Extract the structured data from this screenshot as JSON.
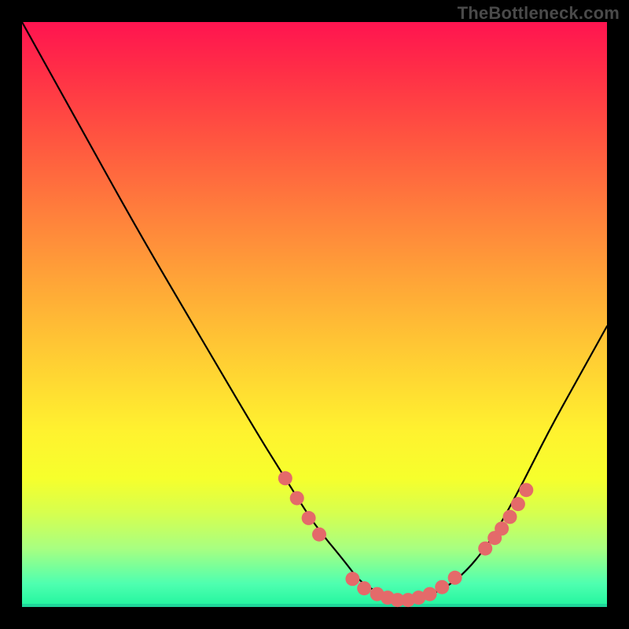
{
  "watermark": "TheBottleneck.com",
  "chart_data": {
    "type": "line",
    "title": "",
    "xlabel": "",
    "ylabel": "",
    "xlim": [
      0,
      1
    ],
    "ylim": [
      0,
      1
    ],
    "grid": false,
    "legend": false,
    "background": "rainbow-gradient",
    "series": [
      {
        "name": "bottleneck-curve",
        "color": "#000000",
        "x": [
          0.0,
          0.1,
          0.2,
          0.3,
          0.4,
          0.45,
          0.5,
          0.55,
          0.58,
          0.62,
          0.66,
          0.7,
          0.75,
          0.8,
          0.85,
          0.9,
          0.95,
          1.0
        ],
        "y": [
          1.0,
          0.82,
          0.64,
          0.47,
          0.3,
          0.22,
          0.14,
          0.08,
          0.04,
          0.02,
          0.01,
          0.02,
          0.05,
          0.11,
          0.2,
          0.3,
          0.39,
          0.48
        ]
      }
    ],
    "markers": [
      {
        "name": "highlight-dots",
        "color": "#e46a6a",
        "radius": 9,
        "points": [
          {
            "x": 0.45,
            "y": 0.22
          },
          {
            "x": 0.47,
            "y": 0.186
          },
          {
            "x": 0.49,
            "y": 0.152
          },
          {
            "x": 0.508,
            "y": 0.124
          },
          {
            "x": 0.565,
            "y": 0.048
          },
          {
            "x": 0.585,
            "y": 0.032
          },
          {
            "x": 0.607,
            "y": 0.022
          },
          {
            "x": 0.625,
            "y": 0.016
          },
          {
            "x": 0.642,
            "y": 0.012
          },
          {
            "x": 0.66,
            "y": 0.012
          },
          {
            "x": 0.678,
            "y": 0.016
          },
          {
            "x": 0.697,
            "y": 0.022
          },
          {
            "x": 0.718,
            "y": 0.034
          },
          {
            "x": 0.74,
            "y": 0.05
          },
          {
            "x": 0.792,
            "y": 0.1
          },
          {
            "x": 0.808,
            "y": 0.118
          },
          {
            "x": 0.82,
            "y": 0.134
          },
          {
            "x": 0.834,
            "y": 0.154
          },
          {
            "x": 0.848,
            "y": 0.176
          },
          {
            "x": 0.862,
            "y": 0.2
          }
        ]
      }
    ]
  }
}
